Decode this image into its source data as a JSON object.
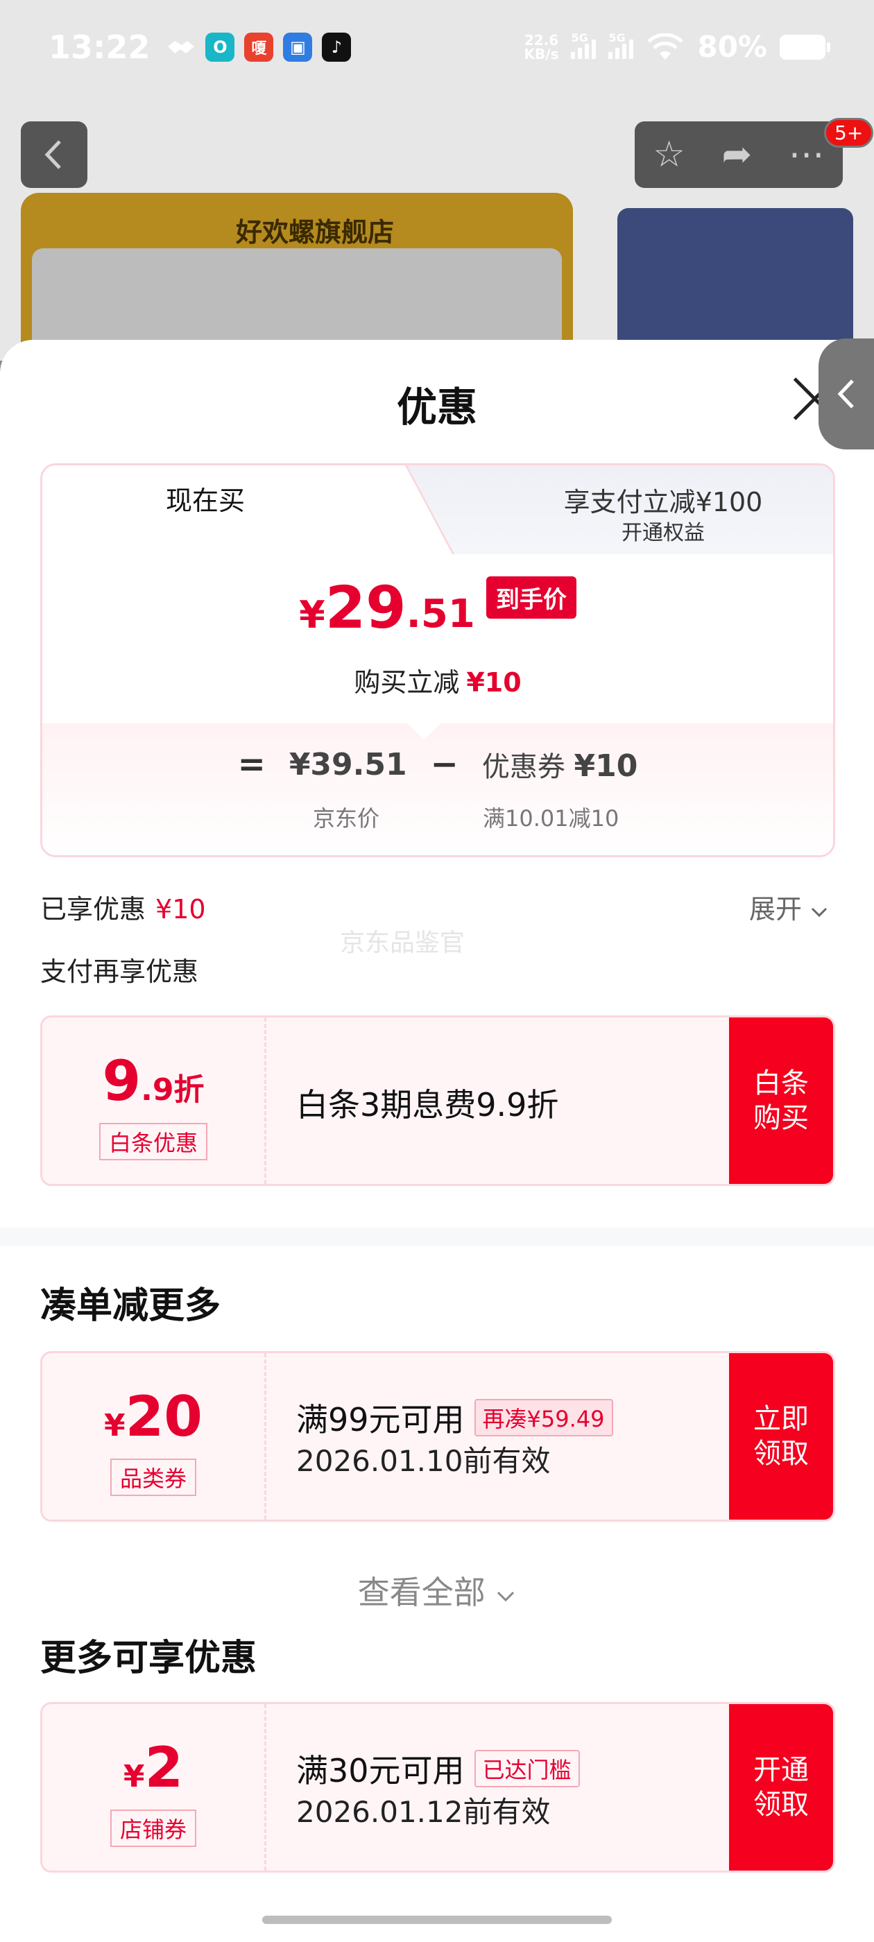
{
  "status_bar": {
    "time": "13:22",
    "apps": [
      "handshake-icon",
      "O",
      "嗄",
      "app-icon",
      "tiktok-icon"
    ],
    "net_speed_value": "22.6",
    "net_speed_unit": "KB/s",
    "signal1": "5G",
    "signal2": "5G",
    "battery": "80%"
  },
  "background": {
    "store_name": "好欢螺旗舰店",
    "notif_badge": "5+"
  },
  "sheet": {
    "title": "优惠",
    "tabs": {
      "now_label": "现在买",
      "pay_label": "享支付立减¥100",
      "pay_sub": "开通权益"
    },
    "price": {
      "yen": "¥",
      "int": "29",
      "dec": ".51",
      "tag": "到手价",
      "discount_text": "购买立减",
      "discount_value": "¥10"
    },
    "calc": {
      "eq": "=",
      "base_price": "¥39.51",
      "minus": "−",
      "coupon_label": "优惠券",
      "coupon_value": "¥10",
      "base_caption": "京东价",
      "coupon_caption": "满10.01减10"
    },
    "enjoyed_label": "已享优惠",
    "enjoyed_value": "¥10",
    "expand_label": "展开",
    "watermark": "京东品鉴官",
    "pay_more_title": "支付再享优惠",
    "baitiao": {
      "amount_big": "9",
      "amount_small": ".9折",
      "tag": "白条优惠",
      "desc": "白条3期息费9.9折",
      "button": "白条购买"
    },
    "section_more": "凑单减更多",
    "coupon1": {
      "yen": "¥",
      "amount": "20",
      "tag": "品类券",
      "condition": "满99元可用",
      "badge": "再凑¥59.49",
      "expiry": "2026.01.10前有效",
      "button": "立即领取"
    },
    "view_all": "查看全部",
    "section_extra": "更多可享优惠",
    "coupon2": {
      "yen": "¥",
      "amount": "2",
      "tag": "店铺券",
      "condition": "满30元可用",
      "badge": "已达门槛",
      "expiry": "2026.01.12前有效",
      "button": "开通领取"
    }
  },
  "colors": {
    "accent_red": "#e5002f",
    "button_red": "#f5001e",
    "pink_border": "#fbd6dc"
  }
}
